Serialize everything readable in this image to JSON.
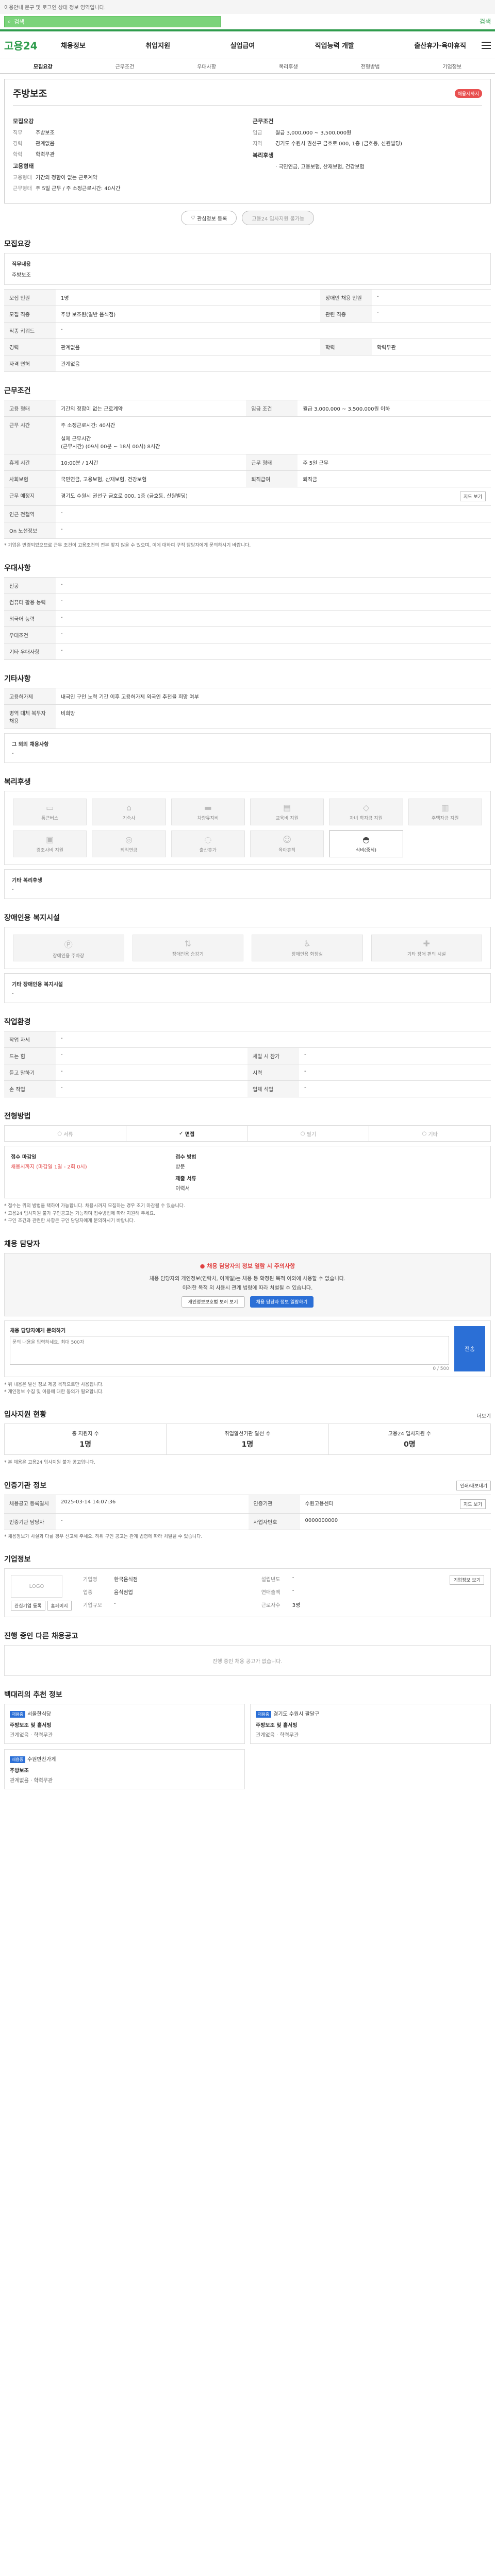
{
  "top_note": "이용안내 문구 및 로그인 상태 정보 영역입니다.",
  "search": {
    "placeholder": "검색",
    "button": "검색"
  },
  "gnb": {
    "logo": "고용24",
    "menu": [
      "채용정보",
      "취업지원",
      "실업급여",
      "직업능력 개발",
      "출산휴가·육아휴직"
    ]
  },
  "tabs": [
    "모집요강",
    "근무조건",
    "우대사항",
    "복리후생",
    "전형방법",
    "기업정보"
  ],
  "job": {
    "title": "주방보조",
    "badge": "채용시까지",
    "left_block_title": "모집요강",
    "left_rows": [
      {
        "k": "직무",
        "v": "주방보조"
      },
      {
        "k": "경력",
        "v": "관계없음"
      },
      {
        "k": "학력",
        "v": "학력무관"
      }
    ],
    "left_block2_title": "고용형태",
    "left_rows2": [
      {
        "k": "고용형태",
        "v": "기간의 정함이 없는 근로계약"
      },
      {
        "k": "근무형태",
        "v": "주 5일 근무 / 주 소정근로시간: 40시간"
      }
    ],
    "right_block_title": "근무조건",
    "right_rows": [
      {
        "k": "임금",
        "v": "월급 3,000,000 ~ 3,500,000원"
      },
      {
        "k": "지역",
        "v": "경기도 수원시 권선구 금호로 000, 1층 (금호동, 신원빌딩)"
      }
    ],
    "right_block2_title": "복리후생",
    "right_rows2": [
      {
        "k": "",
        "v": "· 국민연금, 고용보험, 산재보험, 건강보험"
      }
    ],
    "btn_save": "관심정보 등록",
    "btn_apply": "고용24 입사지원 불가능"
  },
  "recruit": {
    "title": "모집요강",
    "box_label": "직무내용",
    "box_value": "주방보조",
    "rows": [
      [
        "모집 인원",
        "1명",
        "장애인 채용 인원",
        "-"
      ],
      [
        "모집 직종",
        "주방 보조원(일반 음식점)",
        "관련 직종",
        "-"
      ],
      [
        "직종 키워드",
        "-",
        "",
        ""
      ],
      [
        "경력",
        "관계없음",
        "학력",
        "학력무관"
      ],
      [
        "자격 면허",
        "관계없음",
        "",
        ""
      ]
    ]
  },
  "condition": {
    "title": "근무조건",
    "rows": [
      [
        "고용 형태",
        "기간의 정함이 없는 근로계약",
        "임금 조건",
        "월급 3,000,000 ~ 3,500,000원 이하"
      ],
      [
        "근무 시간",
        "주 소정근로시간: 40시간\n\n실제 근무시간\n(근무시간) (09시 00분 ~ 18시 00시) 8시간",
        "",
        ""
      ],
      [
        "휴게 시간",
        "10:00분 / 1시간",
        "근무 형태",
        "주 5일 근무"
      ],
      [
        "사회보험",
        "국민연금, 고용보험, 산재보험, 건강보험",
        "퇴직급여",
        "퇴직금"
      ],
      [
        "근무 예정지",
        "경기도 수원시 권선구 금호로 000, 1층 (금호동, 신원빌딩)",
        "",
        ""
      ],
      [
        "인근 전철역",
        "-",
        "",
        ""
      ],
      [
        "On 노선정보",
        "-",
        "",
        ""
      ]
    ],
    "map_btn": "지도 보기",
    "note": "* 기업은 변경되었으므로 근무 조건이 고용조건의 전부 맞지 않을 수 있으며, 이에 대하여 구직 담당자에게 문의하시기 바랍니다."
  },
  "prefer": {
    "title": "우대사항",
    "rows": [
      [
        "전공",
        "-"
      ],
      [
        "컴퓨터 활용 능력",
        "-"
      ],
      [
        "외국어 능력",
        "-"
      ],
      [
        "우대조건",
        "-"
      ],
      [
        "기타 우대사항",
        "-"
      ]
    ]
  },
  "other": {
    "title": "기타사항",
    "rows": [
      [
        "고용허가제",
        "내국인 구인 노력 기간 이후 고용허가제 외국인 추천을 희망 여부"
      ],
      [
        "병역 대체 복무자 채용",
        "비희망"
      ]
    ],
    "box_label": "그 외의 채용사항",
    "box_value": "-"
  },
  "welfare": {
    "title": "복리후생",
    "items": [
      "통근버스",
      "기숙사",
      "차량유지비",
      "교육비 지원",
      "자녀 학자금 지원",
      "주택자금 지원",
      "경조사비 지원",
      "퇴직연금",
      "출산휴가",
      "육아휴직",
      "식비(중식)"
    ],
    "box_label": "기타 복리후생",
    "box_value": "-"
  },
  "disability": {
    "title": "장애인용 복지시설",
    "items": [
      "장애인용 주차장",
      "장애인용 승강기",
      "장애인용 화장실",
      "기타 장애 편의 시설"
    ],
    "box_label": "기타 장애인용 복지시설",
    "box_value": "-"
  },
  "env": {
    "title": "작업환경",
    "rows": [
      [
        "작업 자세",
        "-",
        "",
        ""
      ],
      [
        "드는 힘",
        "-",
        "세밀 시 참가",
        "-"
      ],
      [
        "듣고 말하기",
        "-",
        "시력",
        "-"
      ],
      [
        "손 작업",
        "-",
        "업체 석업",
        "-"
      ]
    ]
  },
  "selection": {
    "title": "전형방법",
    "steps": [
      "서류",
      "면접",
      "필기",
      "기타"
    ],
    "active": "면접",
    "apply_label": "접수 마감일",
    "apply_value": "채용시까지 (마감일 1일 - 2회 0시)",
    "method_label": "접수 방법",
    "method_value": "방문",
    "papers_label": "제출 서류",
    "papers_value": "이력서",
    "notes": "* 접수는 위의 방법을 택하여 가능합니다. 채용시까지 모집하는 경우 조기 마감될 수 있습니다.\n* 고용24 입사지원 불가 구인공고는 가능하며 접수방법에 따라 지원해 주세요.\n* 구인 조건과 관련한 사항은 구인 담당자에게 문의하시기 바랍니다."
  },
  "contact": {
    "title": "채용 담당자",
    "warn": "채용 담당자의 정보 열람 시 주의사항",
    "p1": "채용 담당자의 개인정보(연락처, 이메일)는 채용 등 확정된 목적 이외에 사용할 수 없습니다.",
    "p2": "이러한 목적 외 사용시 관계 법령에 따라 처벌될 수 있습니다.",
    "btn_check": "개인정보보호법 보러 보기",
    "btn_view": "채용 담당자 정보 열람하기",
    "inquiry_label": "채용 담당자에게 문의하기",
    "inquiry_placeholder": "문의 내용을 입력하세요. 최대 500자",
    "inquiry_count": "0 / 500",
    "send": "전송",
    "notes": "* 위 내용은 발신 정보 제공 목적으로만 사용됩니다.\n* 개인정보 수집 및 이용에 대한 동의가 필요합니다."
  },
  "counts": {
    "title": "입사지원 현황",
    "more": "더보기",
    "items": [
      {
        "label": "총 지원자 수",
        "num": "1명"
      },
      {
        "label": "취업알선기관 알선 수",
        "num": "1명"
      },
      {
        "label": "고용24 입사지원 수",
        "num": "0명"
      }
    ],
    "note": "* 본 채용은 고용24 입사지원 불가 공고입니다."
  },
  "info": {
    "title": "인증기관 정보",
    "print_btn": "인쇄/내보내기",
    "rows": [
      [
        "채용공고 등록일시",
        "2025-03-14 14:07:36",
        "인증기관",
        "수원고용센터"
      ],
      [
        "인증기관 담당자",
        "-",
        "사업자번호",
        "0000000000"
      ]
    ],
    "map_btn": "지도 보기",
    "note": "* 채용정보가 사실과 다를 경우 신고해 주세요. 허위 구인 공고는 관계 법령에 따라 처벌될 수 있습니다."
  },
  "company": {
    "title": "기업정보",
    "logo": "LOGO",
    "name_label": "기업명",
    "name": "한국음식점",
    "industry_label": "업종",
    "industry": "음식점업",
    "scale_label": "기업규모",
    "scale": "-",
    "btn_fav": "관심기업 등록",
    "btn_home": "홈페이지",
    "rows": [
      [
        "설립년도",
        "-"
      ],
      [
        "연매출액",
        "-"
      ],
      [
        "근로자수",
        "3명"
      ]
    ],
    "btn_detail": "기업정보 보기"
  },
  "others": {
    "title": "진행 중인 다른 채용공고",
    "empty": "진행 중인 채용 공고가 없습니다."
  },
  "recommend": {
    "title": "백대리의 추천 정보",
    "cards": [
      {
        "tag": "채용중",
        "co": "서울한식당",
        "t": "주방보조 및 홀서빙",
        "r": "관계없음 · 학력무관"
      },
      {
        "tag": "채용중",
        "co": "경기도 수원시 팔달구",
        "t": "주방보조 및 홀서빙",
        "r": "관계없음 · 학력무관"
      },
      {
        "tag": "채용중",
        "co": "수원반찬가게",
        "t": "주방보조",
        "r": "관계없음 · 학력무관"
      }
    ]
  }
}
